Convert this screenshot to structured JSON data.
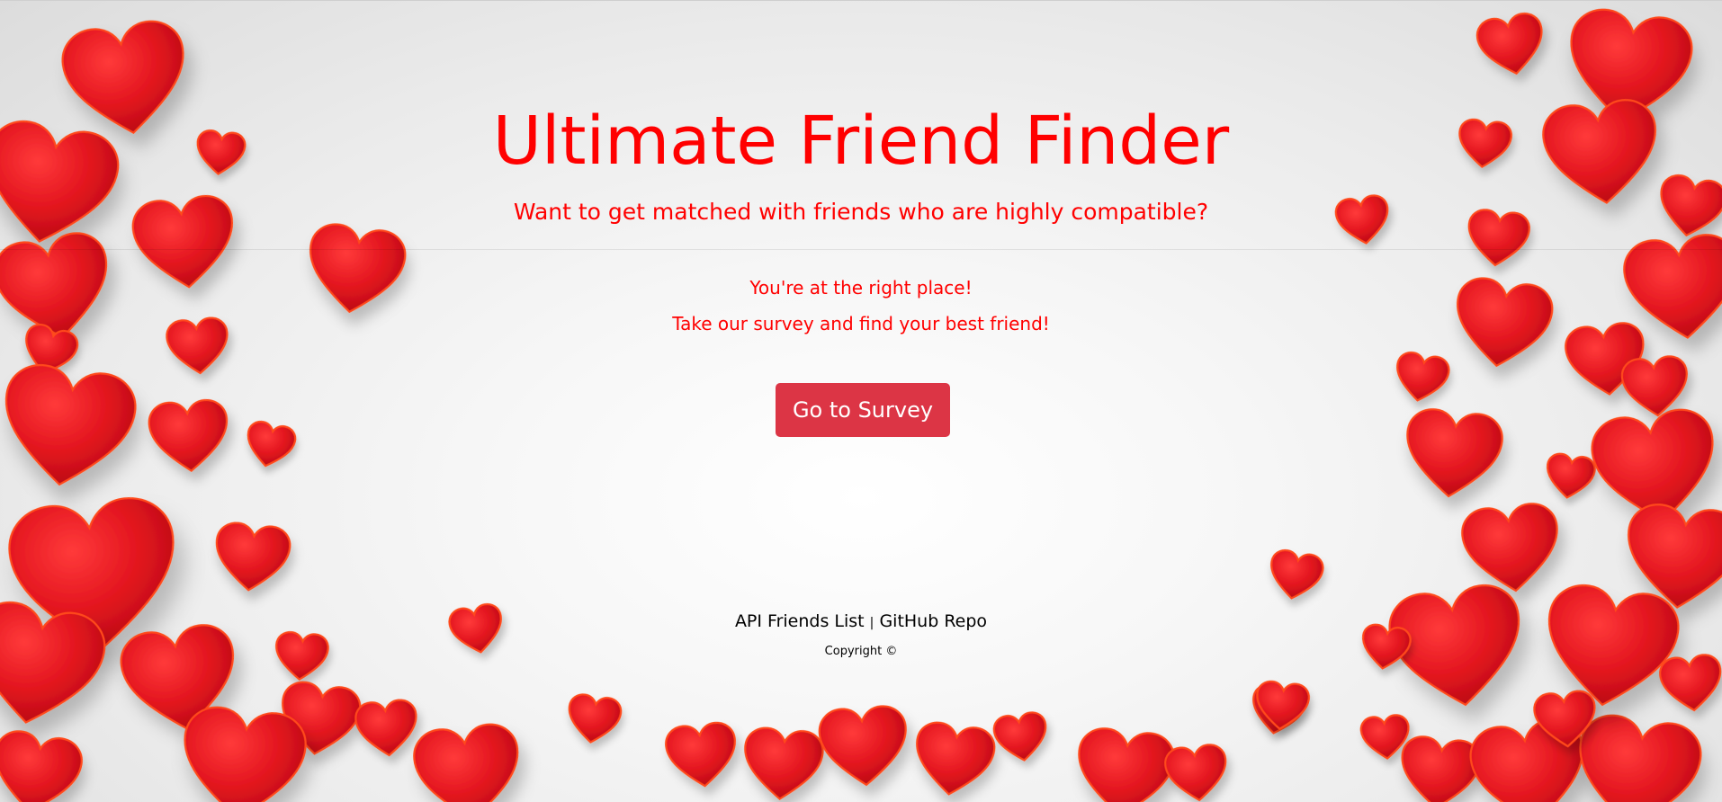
{
  "header": {
    "title": "Ultimate Friend Finder",
    "subtitle": "Want to get matched with friends who are highly compatible?"
  },
  "main": {
    "line1": "You're at the right place!",
    "line2": "Take our survey and find your best friend!",
    "survey_button_label": "Go to Survey"
  },
  "footer": {
    "api_link": "API Friends List",
    "separator": "|",
    "github_link": "GitHub Repo",
    "copyright": "Copyright ©"
  },
  "background": {
    "icon": "heart-icon",
    "heart_color": "#d7131d",
    "heart_edge_color": "#ff4a1a"
  },
  "colors": {
    "accent_text": "#ff0000",
    "button": "#dc3545"
  }
}
